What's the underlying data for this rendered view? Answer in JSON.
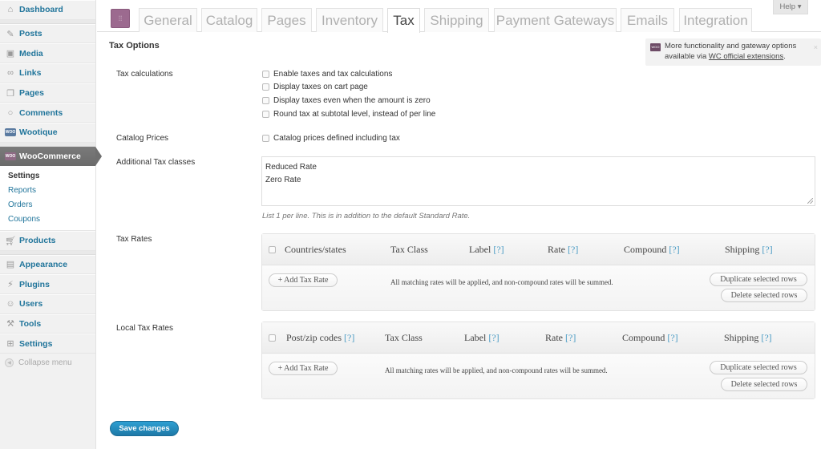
{
  "sidebar": {
    "items": [
      {
        "label": "Dashboard",
        "icon": "dashboard-icon"
      },
      {
        "label": "Posts",
        "icon": "posts-icon"
      },
      {
        "label": "Media",
        "icon": "media-icon"
      },
      {
        "label": "Links",
        "icon": "links-icon"
      },
      {
        "label": "Pages",
        "icon": "pages-icon"
      },
      {
        "label": "Comments",
        "icon": "comments-icon"
      },
      {
        "label": "Wootique",
        "icon": "woo-icon"
      },
      {
        "label": "WooCommerce",
        "icon": "woo-icon"
      },
      {
        "label": "Products",
        "icon": "cart-icon"
      },
      {
        "label": "Appearance",
        "icon": "appearance-icon"
      },
      {
        "label": "Plugins",
        "icon": "plugins-icon"
      },
      {
        "label": "Users",
        "icon": "users-icon"
      },
      {
        "label": "Tools",
        "icon": "tools-icon"
      },
      {
        "label": "Settings",
        "icon": "settings-icon"
      }
    ],
    "woo_icon_text": "WOO",
    "submenu": [
      "Settings",
      "Reports",
      "Orders",
      "Coupons"
    ],
    "collapse_label": "Collapse menu"
  },
  "header": {
    "help_label": "Help ▾",
    "tabs": [
      "General",
      "Catalog",
      "Pages",
      "Inventory",
      "Tax",
      "Shipping",
      "Payment Gateways",
      "Emails",
      "Integration"
    ],
    "active_tab": "Tax"
  },
  "notice": {
    "icon_text": "WOO",
    "text": "More functionality and gateway options available via ",
    "link": "WC official extensions",
    "suffix": ".",
    "close": "×"
  },
  "tax_options": {
    "title": "Tax Options",
    "tax_calculations": {
      "label": "Tax calculations",
      "options": [
        {
          "label": "Enable taxes and tax calculations",
          "checked": false
        },
        {
          "label": "Display taxes on cart page",
          "checked": false
        },
        {
          "label": "Display taxes even when the amount is zero",
          "checked": false
        },
        {
          "label": "Round tax at subtotal level, instead of per line",
          "checked": false
        }
      ]
    },
    "catalog_prices": {
      "label": "Catalog Prices",
      "option": {
        "label": "Catalog prices defined including tax",
        "checked": false
      }
    },
    "tax_classes": {
      "label": "Additional Tax classes",
      "value": "Reduced Rate\nZero Rate",
      "hint": "List 1 per line. This is in addition to the default Standard Rate."
    },
    "tax_rates": {
      "label": "Tax Rates",
      "columns": [
        {
          "label": "Countries/states",
          "help": ""
        },
        {
          "label": "Tax Class",
          "help": ""
        },
        {
          "label": "Label ",
          "help": "[?]"
        },
        {
          "label": "Rate ",
          "help": "[?]"
        },
        {
          "label": "Compound ",
          "help": "[?]"
        },
        {
          "label": "Shipping ",
          "help": "[?]"
        }
      ],
      "add_button": "+ Add Tax Rate",
      "note": "All matching rates will be applied, and non-compound rates will be summed.",
      "duplicate_button": "Duplicate selected rows",
      "delete_button": "Delete selected rows"
    },
    "local_tax_rates": {
      "label": "Local Tax Rates",
      "columns": [
        {
          "label": "Post/zip codes ",
          "help": "[?]"
        },
        {
          "label": "Tax Class",
          "help": ""
        },
        {
          "label": "Label ",
          "help": "[?]"
        },
        {
          "label": "Rate ",
          "help": "[?]"
        },
        {
          "label": "Compound ",
          "help": "[?]"
        },
        {
          "label": "Shipping ",
          "help": "[?]"
        }
      ],
      "add_button": "+ Add Tax Rate",
      "note": "All matching rates will be applied, and non-compound rates will be summed.",
      "duplicate_button": "Duplicate selected rows",
      "delete_button": "Delete selected rows"
    }
  },
  "save_button": "Save changes"
}
